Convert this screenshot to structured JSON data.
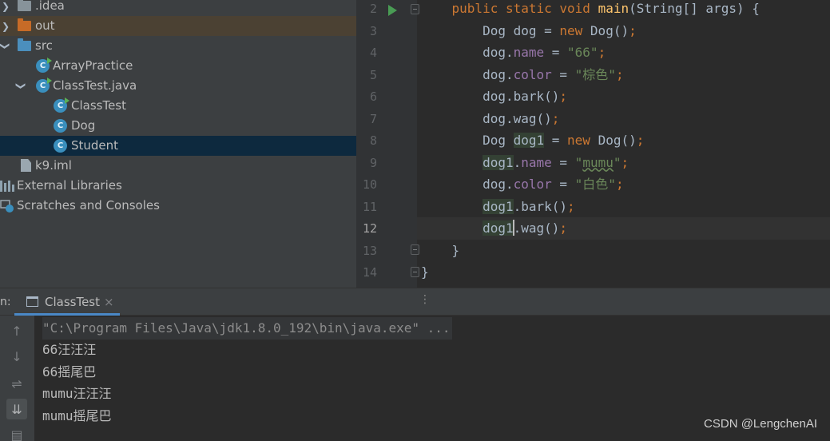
{
  "project_tree": {
    "items": [
      {
        "label": ".idea",
        "icon": "folder-icon"
      },
      {
        "label": "out",
        "icon": "folder-icon"
      },
      {
        "label": "src",
        "icon": "source-folder-icon"
      },
      {
        "label": "ArrayPractice",
        "icon": "java-class-icon"
      },
      {
        "label": "ClassTest.java",
        "icon": "java-file-icon"
      },
      {
        "label": "ClassTest",
        "icon": "java-class-icon"
      },
      {
        "label": "Dog",
        "icon": "java-class-icon"
      },
      {
        "label": "Student",
        "icon": "java-class-icon"
      },
      {
        "label": "k9.iml",
        "icon": "iml-file-icon"
      },
      {
        "label": "External Libraries",
        "icon": "libraries-icon"
      },
      {
        "label": "Scratches and Consoles",
        "icon": "scratches-icon"
      }
    ]
  },
  "editor": {
    "current_line": 12,
    "lines": [
      {
        "n": "2",
        "t": [
          [
            "    ",
            ""
          ],
          [
            "public static void ",
            "kw"
          ],
          [
            "main",
            "fn"
          ],
          [
            "(String[] args) {",
            ""
          ]
        ]
      },
      {
        "n": "3",
        "t": [
          [
            "        Dog dog = ",
            ""
          ],
          [
            "new ",
            "kw"
          ],
          [
            "Dog()",
            ""
          ],
          [
            ";",
            "semi"
          ]
        ]
      },
      {
        "n": "4",
        "t": [
          [
            "        dog.",
            ""
          ],
          [
            "name",
            "fld"
          ],
          [
            " = ",
            ""
          ],
          [
            "\"66\"",
            "str"
          ],
          [
            ";",
            "semi"
          ]
        ]
      },
      {
        "n": "5",
        "t": [
          [
            "        dog.",
            ""
          ],
          [
            "color",
            "fld"
          ],
          [
            " = ",
            ""
          ],
          [
            "\"棕色\"",
            "str"
          ],
          [
            ";",
            "semi"
          ]
        ]
      },
      {
        "n": "6",
        "t": [
          [
            "        dog.bark()",
            ""
          ],
          [
            ";",
            "semi"
          ]
        ]
      },
      {
        "n": "7",
        "t": [
          [
            "        dog.wag()",
            ""
          ],
          [
            ";",
            "semi"
          ]
        ]
      },
      {
        "n": "8",
        "t": [
          [
            "        Dog ",
            ""
          ],
          [
            "dog1",
            "hlvar"
          ],
          [
            " = ",
            ""
          ],
          [
            "new ",
            "kw"
          ],
          [
            "Dog()",
            ""
          ],
          [
            ";",
            "semi"
          ]
        ]
      },
      {
        "n": "9",
        "t": [
          [
            "        ",
            ""
          ],
          [
            "dog1",
            "hlvar"
          ],
          [
            ".",
            ""
          ],
          [
            "name",
            "fld"
          ],
          [
            " = ",
            ""
          ],
          [
            "\"",
            "str"
          ],
          [
            "mumu",
            "str typo"
          ],
          [
            "\"",
            "str"
          ],
          [
            ";",
            "semi"
          ]
        ]
      },
      {
        "n": "10",
        "t": [
          [
            "        dog.",
            ""
          ],
          [
            "color",
            "fld"
          ],
          [
            " = ",
            ""
          ],
          [
            "\"白色\"",
            "str"
          ],
          [
            ";",
            "semi"
          ]
        ]
      },
      {
        "n": "11",
        "t": [
          [
            "        ",
            ""
          ],
          [
            "dog1",
            "hlvar"
          ],
          [
            ".bark()",
            ""
          ],
          [
            ";",
            "semi"
          ]
        ]
      },
      {
        "n": "12",
        "t": [
          [
            "        ",
            ""
          ],
          [
            "dog1",
            "hlvar"
          ],
          [
            "|",
            "cursor"
          ],
          [
            ".wag()",
            ""
          ],
          [
            ";",
            "semi"
          ]
        ]
      },
      {
        "n": "13",
        "t": [
          [
            "    }",
            ""
          ]
        ]
      },
      {
        "n": "14",
        "t": [
          [
            "}",
            ""
          ]
        ]
      }
    ]
  },
  "run_panel": {
    "prefix": "n:",
    "tab_label": "ClassTest",
    "tab_close": "×",
    "more": "⋮"
  },
  "console": {
    "command": "\"C:\\Program Files\\Java\\jdk1.8.0_192\\bin\\java.exe\" ...",
    "output": [
      "66汪汪汪",
      "66摇尾巴",
      "mumu汪汪汪",
      "mumu摇尾巴"
    ]
  },
  "toolbar": {
    "buttons": [
      {
        "name": "scroll-up-icon",
        "glyph": "↑"
      },
      {
        "name": "scroll-down-icon",
        "glyph": "↓"
      },
      {
        "name": "soft-wrap-icon",
        "glyph": "⇌"
      },
      {
        "name": "scroll-to-end-icon",
        "glyph": "⇊"
      },
      {
        "name": "print-icon",
        "glyph": "▤"
      }
    ]
  },
  "watermark": "CSDN @LengchenAI",
  "colors": {
    "panel": "#3c3f41",
    "editor_bg": "#2b2b2b",
    "keyword": "#cc7832",
    "string": "#6a8759",
    "field": "#9876aa",
    "method": "#ffc66d",
    "selection": "#0d293e"
  }
}
